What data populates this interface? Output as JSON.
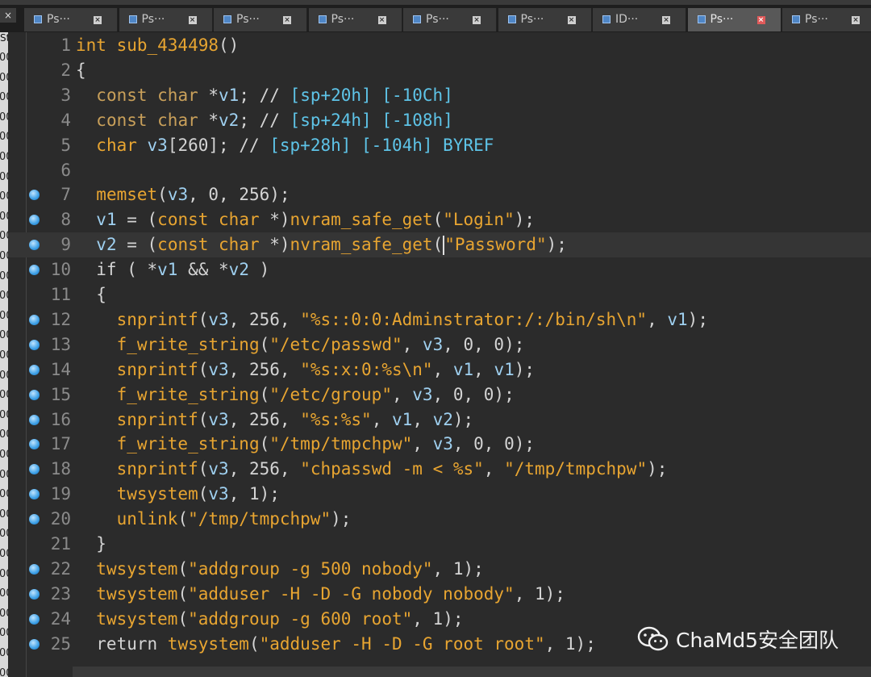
{
  "window": {
    "close_glyph": "×",
    "top_strip_fragment": "y"
  },
  "tabs": [
    {
      "label": "Ps···",
      "active": false
    },
    {
      "label": "Ps···",
      "active": false
    },
    {
      "label": "Ps···",
      "active": false
    },
    {
      "label": "Ps···",
      "active": false
    },
    {
      "label": "Ps···",
      "active": false
    },
    {
      "label": "Ps···",
      "active": false
    },
    {
      "label": "ID···",
      "active": false
    },
    {
      "label": "Ps···",
      "active": true
    },
    {
      "label": "Ps···",
      "active": false
    }
  ],
  "left_pane": {
    "title_fragment": "St",
    "row_fragment": "00"
  },
  "code_lines": [
    {
      "num": "1",
      "dot": false,
      "tokens": [
        [
          "kw",
          "int "
        ],
        [
          "fn",
          "sub_434498"
        ],
        [
          "pl",
          "()"
        ]
      ]
    },
    {
      "num": "2",
      "dot": false,
      "tokens": [
        [
          "pl",
          "{"
        ]
      ]
    },
    {
      "num": "3",
      "dot": false,
      "tokens": [
        [
          "pl",
          "  "
        ],
        [
          "ty",
          "const char "
        ],
        [
          "pl",
          "*"
        ],
        [
          "va",
          "v1"
        ],
        [
          "pl",
          "; // "
        ],
        [
          "rf",
          "[sp+20h] [-10Ch]"
        ]
      ]
    },
    {
      "num": "4",
      "dot": false,
      "tokens": [
        [
          "pl",
          "  "
        ],
        [
          "ty",
          "const char "
        ],
        [
          "pl",
          "*"
        ],
        [
          "va",
          "v2"
        ],
        [
          "pl",
          "; // "
        ],
        [
          "rf",
          "[sp+24h] [-108h]"
        ]
      ]
    },
    {
      "num": "5",
      "dot": false,
      "tokens": [
        [
          "pl",
          "  "
        ],
        [
          "kw",
          "char "
        ],
        [
          "va",
          "v3"
        ],
        [
          "pl",
          "[260]; // "
        ],
        [
          "rf",
          "[sp+28h] [-104h] BYREF"
        ]
      ]
    },
    {
      "num": "6",
      "dot": false,
      "tokens": []
    },
    {
      "num": "7",
      "dot": true,
      "tokens": [
        [
          "pl",
          "  "
        ],
        [
          "fn",
          "memset"
        ],
        [
          "pl",
          "("
        ],
        [
          "va",
          "v3"
        ],
        [
          "pl",
          ", 0, 256);"
        ]
      ]
    },
    {
      "num": "8",
      "dot": true,
      "tokens": [
        [
          "pl",
          "  "
        ],
        [
          "va",
          "v1"
        ],
        [
          "pl",
          " = ("
        ],
        [
          "kw",
          "const char "
        ],
        [
          "pl",
          "*)"
        ],
        [
          "fn",
          "nvram_safe_get"
        ],
        [
          "pl",
          "("
        ],
        [
          "st",
          "\"Login\""
        ],
        [
          "pl",
          ");"
        ]
      ]
    },
    {
      "num": "9",
      "dot": true,
      "cursor": true,
      "tokens": [
        [
          "pl",
          "  "
        ],
        [
          "va",
          "v2"
        ],
        [
          "pl",
          " = ("
        ],
        [
          "kw",
          "const char "
        ],
        [
          "pl",
          "*)"
        ],
        [
          "fn",
          "nvram_safe_get"
        ],
        [
          "pl",
          "("
        ],
        [
          "caret",
          ""
        ],
        [
          "st",
          "\"Password\""
        ],
        [
          "pl",
          ");"
        ]
      ]
    },
    {
      "num": "10",
      "dot": true,
      "tokens": [
        [
          "pl",
          "  if ( *"
        ],
        [
          "va",
          "v1"
        ],
        [
          "pl",
          " && *"
        ],
        [
          "va",
          "v2"
        ],
        [
          "pl",
          " )"
        ]
      ]
    },
    {
      "num": "11",
      "dot": false,
      "tokens": [
        [
          "pl",
          "  {"
        ]
      ]
    },
    {
      "num": "12",
      "dot": true,
      "tokens": [
        [
          "pl",
          "    "
        ],
        [
          "fn",
          "snprintf"
        ],
        [
          "pl",
          "("
        ],
        [
          "va",
          "v3"
        ],
        [
          "pl",
          ", 256, "
        ],
        [
          "st",
          "\"%s::0:0:Adminstrator:/:/bin/sh\\n\""
        ],
        [
          "pl",
          ", "
        ],
        [
          "va",
          "v1"
        ],
        [
          "pl",
          ");"
        ]
      ]
    },
    {
      "num": "13",
      "dot": true,
      "tokens": [
        [
          "pl",
          "    "
        ],
        [
          "fn",
          "f_write_string"
        ],
        [
          "pl",
          "("
        ],
        [
          "st",
          "\"/etc/passwd\""
        ],
        [
          "pl",
          ", "
        ],
        [
          "va",
          "v3"
        ],
        [
          "pl",
          ", 0, 0);"
        ]
      ]
    },
    {
      "num": "14",
      "dot": true,
      "tokens": [
        [
          "pl",
          "    "
        ],
        [
          "fn",
          "snprintf"
        ],
        [
          "pl",
          "("
        ],
        [
          "va",
          "v3"
        ],
        [
          "pl",
          ", 256, "
        ],
        [
          "st",
          "\"%s:x:0:%s\\n\""
        ],
        [
          "pl",
          ", "
        ],
        [
          "va",
          "v1"
        ],
        [
          "pl",
          ", "
        ],
        [
          "va",
          "v1"
        ],
        [
          "pl",
          ");"
        ]
      ]
    },
    {
      "num": "15",
      "dot": true,
      "tokens": [
        [
          "pl",
          "    "
        ],
        [
          "fn",
          "f_write_string"
        ],
        [
          "pl",
          "("
        ],
        [
          "st",
          "\"/etc/group\""
        ],
        [
          "pl",
          ", "
        ],
        [
          "va",
          "v3"
        ],
        [
          "pl",
          ", 0, 0);"
        ]
      ]
    },
    {
      "num": "16",
      "dot": true,
      "tokens": [
        [
          "pl",
          "    "
        ],
        [
          "fn",
          "snprintf"
        ],
        [
          "pl",
          "("
        ],
        [
          "va",
          "v3"
        ],
        [
          "pl",
          ", 256, "
        ],
        [
          "st",
          "\"%s:%s\""
        ],
        [
          "pl",
          ", "
        ],
        [
          "va",
          "v1"
        ],
        [
          "pl",
          ", "
        ],
        [
          "va",
          "v2"
        ],
        [
          "pl",
          ");"
        ]
      ]
    },
    {
      "num": "17",
      "dot": true,
      "tokens": [
        [
          "pl",
          "    "
        ],
        [
          "fn",
          "f_write_string"
        ],
        [
          "pl",
          "("
        ],
        [
          "st",
          "\"/tmp/tmpchpw\""
        ],
        [
          "pl",
          ", "
        ],
        [
          "va",
          "v3"
        ],
        [
          "pl",
          ", 0, 0);"
        ]
      ]
    },
    {
      "num": "18",
      "dot": true,
      "tokens": [
        [
          "pl",
          "    "
        ],
        [
          "fn",
          "snprintf"
        ],
        [
          "pl",
          "("
        ],
        [
          "va",
          "v3"
        ],
        [
          "pl",
          ", 256, "
        ],
        [
          "st",
          "\"chpasswd -m < %s\""
        ],
        [
          "pl",
          ", "
        ],
        [
          "st",
          "\"/tmp/tmpchpw\""
        ],
        [
          "pl",
          ");"
        ]
      ]
    },
    {
      "num": "19",
      "dot": true,
      "tokens": [
        [
          "pl",
          "    "
        ],
        [
          "fn",
          "twsystem"
        ],
        [
          "pl",
          "("
        ],
        [
          "va",
          "v3"
        ],
        [
          "pl",
          ", 1);"
        ]
      ]
    },
    {
      "num": "20",
      "dot": true,
      "tokens": [
        [
          "pl",
          "    "
        ],
        [
          "fn",
          "unlink"
        ],
        [
          "pl",
          "("
        ],
        [
          "st",
          "\"/tmp/tmpchpw\""
        ],
        [
          "pl",
          ");"
        ]
      ]
    },
    {
      "num": "21",
      "dot": false,
      "tokens": [
        [
          "pl",
          "  }"
        ]
      ]
    },
    {
      "num": "22",
      "dot": true,
      "tokens": [
        [
          "pl",
          "  "
        ],
        [
          "fn",
          "twsystem"
        ],
        [
          "pl",
          "("
        ],
        [
          "st",
          "\"addgroup -g 500 nobody\""
        ],
        [
          "pl",
          ", 1);"
        ]
      ]
    },
    {
      "num": "23",
      "dot": true,
      "tokens": [
        [
          "pl",
          "  "
        ],
        [
          "fn",
          "twsystem"
        ],
        [
          "pl",
          "("
        ],
        [
          "st",
          "\"adduser -H -D -G nobody nobody\""
        ],
        [
          "pl",
          ", 1);"
        ]
      ]
    },
    {
      "num": "24",
      "dot": true,
      "tokens": [
        [
          "pl",
          "  "
        ],
        [
          "fn",
          "twsystem"
        ],
        [
          "pl",
          "("
        ],
        [
          "st",
          "\"addgroup -g 600 root\""
        ],
        [
          "pl",
          ", 1);"
        ]
      ]
    },
    {
      "num": "25",
      "dot": true,
      "tokens": [
        [
          "pl",
          "  return "
        ],
        [
          "fn",
          "twsystem"
        ],
        [
          "pl",
          "("
        ],
        [
          "st",
          "\"adduser -H -D -G root root\""
        ],
        [
          "pl",
          ", 1);"
        ]
      ]
    }
  ],
  "watermark": {
    "text": "ChaMd5安全团队",
    "icon": "wechat-icon"
  },
  "colors": {
    "background": "#2b2b2b",
    "keyword": "#e8a531",
    "variable": "#9fd0f0",
    "comment_ref": "#5ec4e8",
    "breakpoint": "#3b9fe6"
  }
}
